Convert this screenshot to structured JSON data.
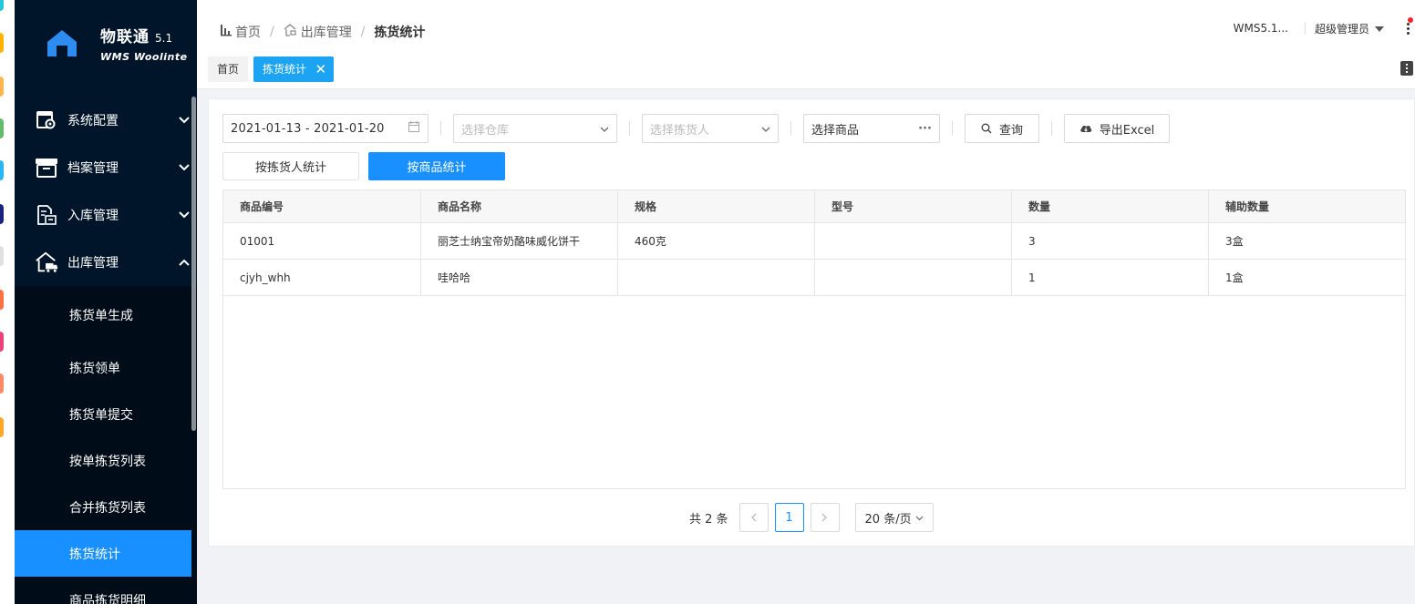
{
  "logo": {
    "title": "物联通",
    "version": "5.1",
    "subtitle": "WMS Woolinte"
  },
  "sidebar": {
    "items": [
      {
        "label": "系统配置",
        "icon": "settings-icon"
      },
      {
        "label": "档案管理",
        "icon": "archive-icon"
      },
      {
        "label": "入库管理",
        "icon": "inbound-icon"
      },
      {
        "label": "出库管理",
        "icon": "outbound-icon"
      }
    ],
    "sub_items": [
      {
        "label": "拣货单生成"
      },
      {
        "label": "拣货领单"
      },
      {
        "label": "拣货单提交"
      },
      {
        "label": "按单拣货列表"
      },
      {
        "label": "合并拣货列表"
      },
      {
        "label": "拣货统计"
      },
      {
        "label": "商品拣货明细"
      }
    ]
  },
  "header": {
    "breadcrumb": [
      "首页",
      "出库管理",
      "拣货统计"
    ],
    "version_label": "WMS5.1...",
    "user_label": "超级管理员"
  },
  "tabs": {
    "home": "首页",
    "active": "拣货统计"
  },
  "filters": {
    "date_range": "2021-01-13 - 2021-01-20",
    "warehouse_placeholder": "选择仓库",
    "picker_placeholder": "选择拣货人",
    "goods_label": "选择商品",
    "goods_more": "···",
    "query_label": "查询",
    "export_label": "导出Excel"
  },
  "segments": {
    "by_picker": "按拣货人统计",
    "by_goods": "按商品统计"
  },
  "table": {
    "columns": [
      "商品编号",
      "商品名称",
      "规格",
      "型号",
      "数量",
      "辅助数量"
    ],
    "rows": [
      [
        "01001",
        "丽芝士纳宝帝奶酪味威化饼干",
        "460克",
        "",
        "3",
        "3盒"
      ],
      [
        "cjyh_whh",
        "哇哈哈",
        "",
        "",
        "1",
        "1盒"
      ]
    ]
  },
  "pagination": {
    "total": "共 2 条",
    "current": "1",
    "page_size": "20 条/页"
  },
  "colors": {
    "sidebar_bg": "#001529",
    "accent": "#1890ff",
    "tab_active": "#1ca3f2"
  }
}
